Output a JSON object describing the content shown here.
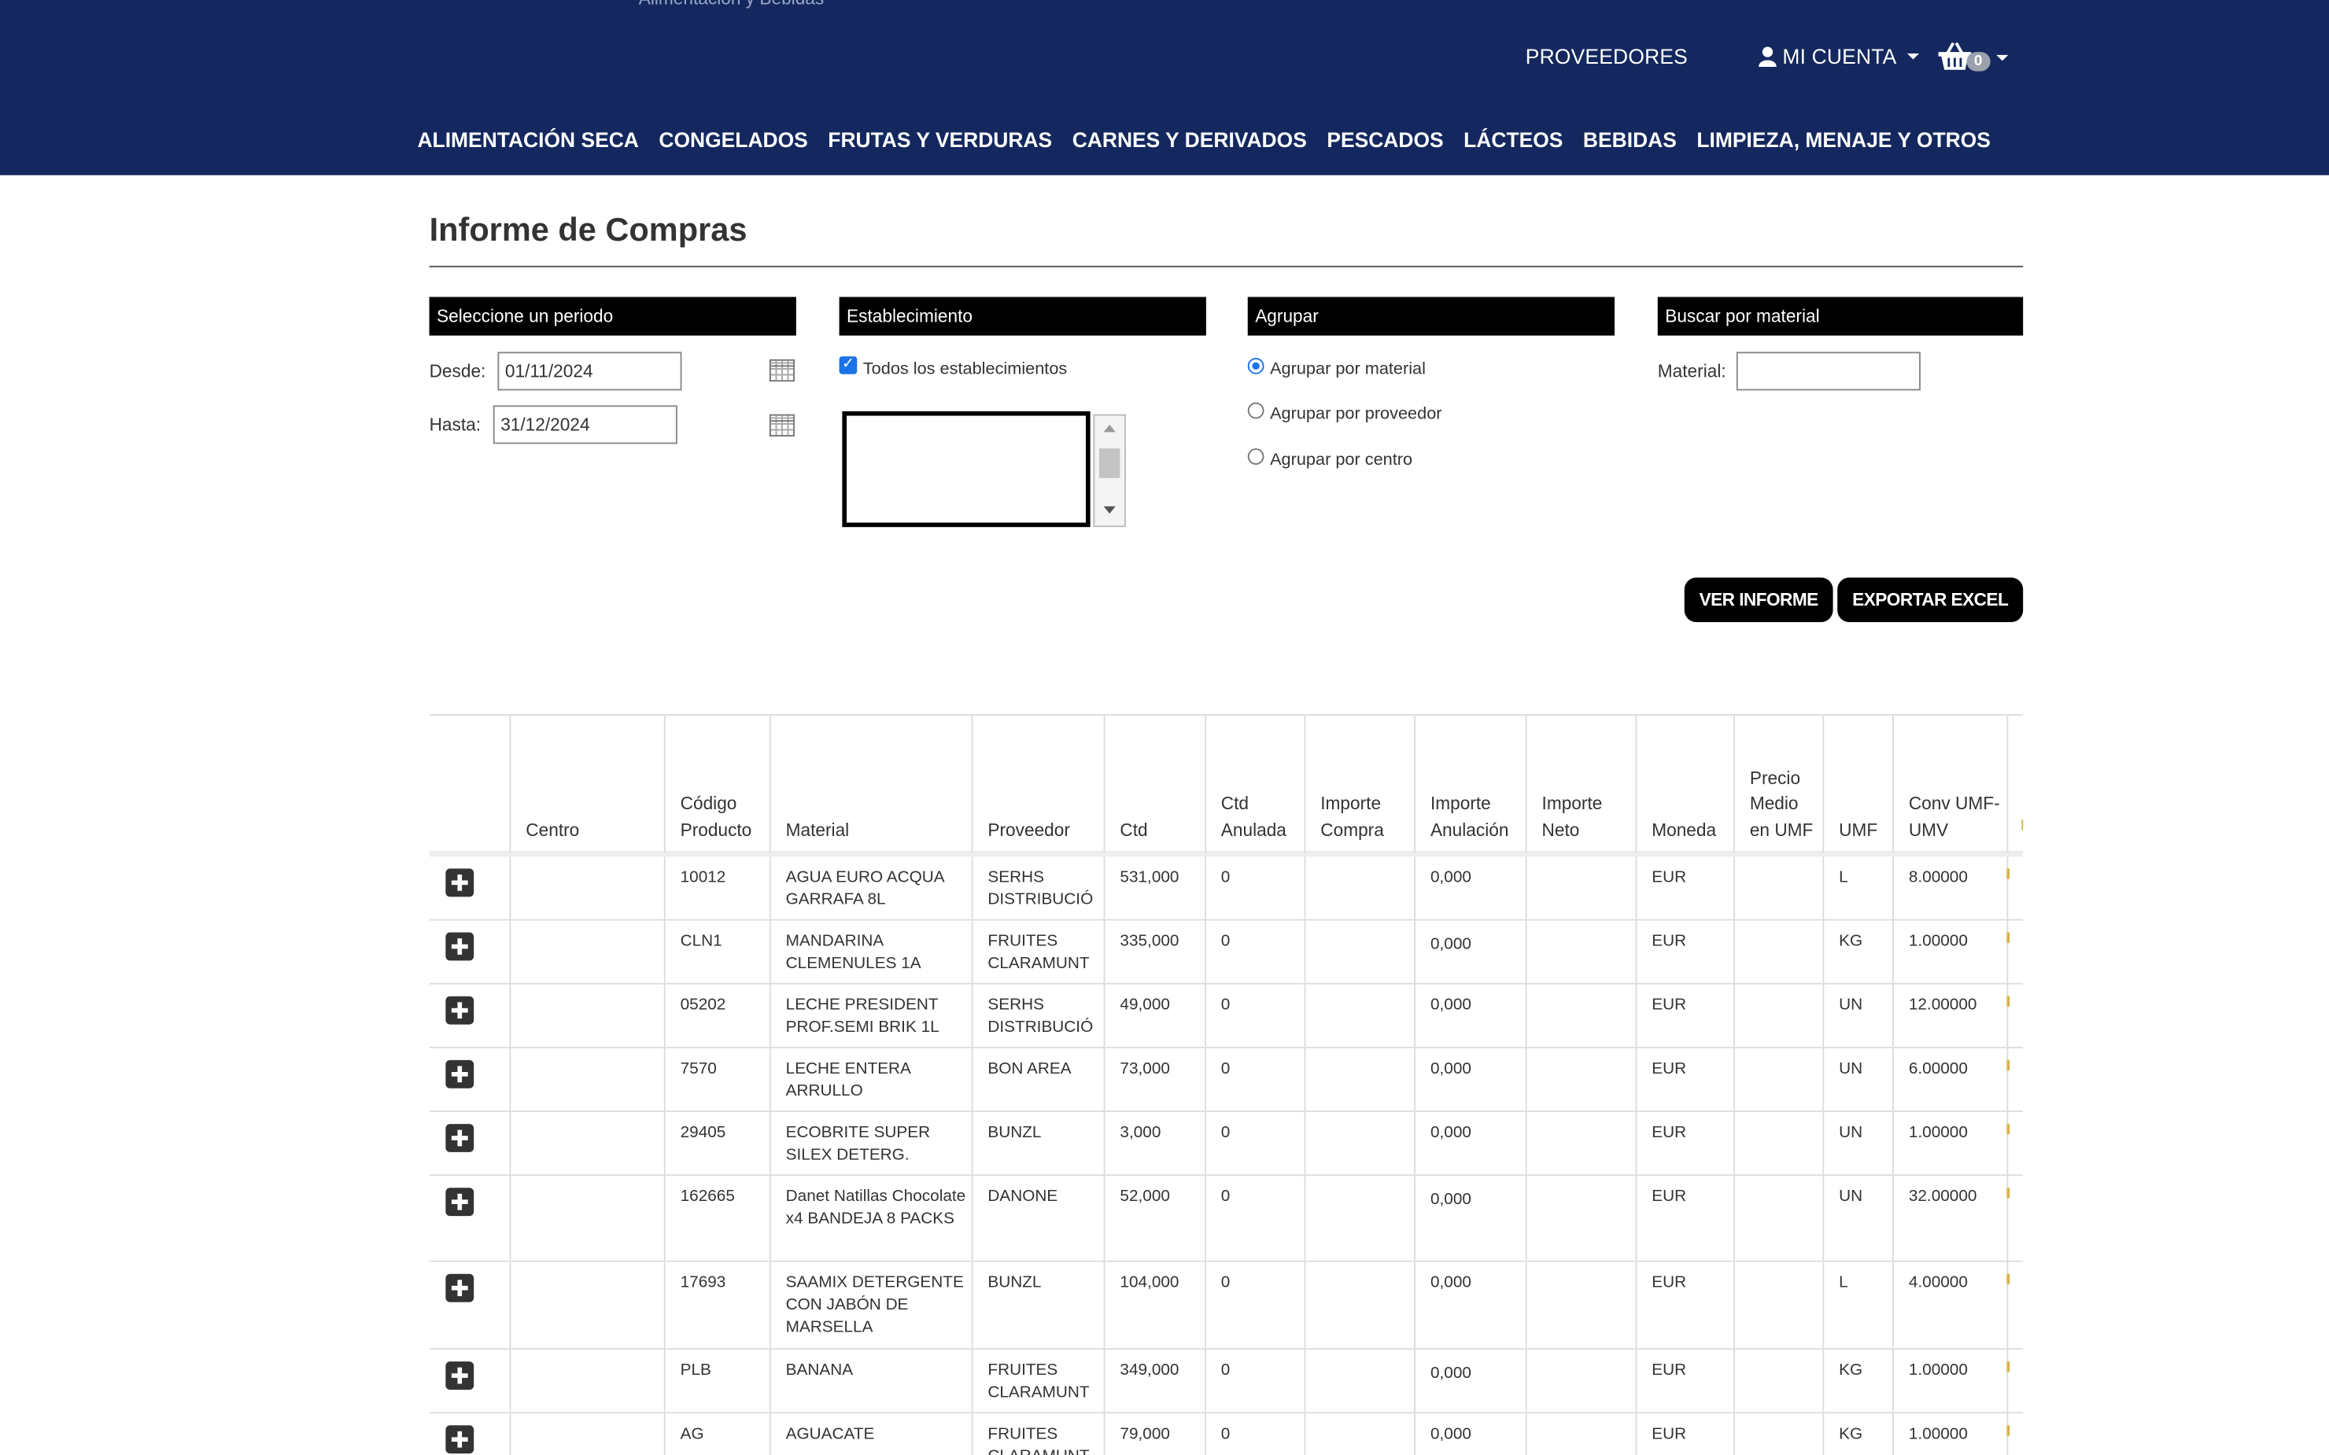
{
  "header": {
    "top_partial_text": "Alimentación y Bebidas",
    "nav_right": {
      "suppliers": "PROVEEDORES",
      "account": "MI CUENTA",
      "cart_count": "0"
    },
    "categories": [
      "ALIMENTACIÓN SECA",
      "CONGELADOS",
      "FRUTAS Y VERDURAS",
      "CARNES Y DERIVADOS",
      "PESCADOS",
      "LÁCTEOS",
      "BEBIDAS",
      "LIMPIEZA, MENAJE Y OTROS"
    ]
  },
  "page": {
    "title": "Informe de Compras"
  },
  "filters": {
    "period": {
      "heading": "Seleccione un periodo",
      "from_label": "Desde:",
      "from_value": "01/11/2024",
      "to_label": "Hasta:",
      "to_value": "31/12/2024"
    },
    "establishment": {
      "heading": "Establecimiento",
      "all_label": "Todos los establecimientos",
      "all_checked": true
    },
    "group": {
      "heading": "Agrupar",
      "options": [
        "Agrupar por material",
        "Agrupar por proveedor",
        "Agrupar por centro"
      ],
      "selected": "Agrupar por material"
    },
    "search": {
      "heading": "Buscar por material",
      "material_label": "Material:",
      "material_value": ""
    }
  },
  "actions": {
    "view_report": "VER INFORME",
    "export_excel": "EXPORTAR EXCEL"
  },
  "table": {
    "headers": [
      "Centro",
      "Código Producto",
      "Material",
      "Proveedor",
      "Ctd",
      "Ctd Anulada",
      "Importe Compra",
      "Importe Anulación",
      "Importe Neto",
      "Moneda",
      "Precio Medio en UMF",
      "UMF",
      "Conv UMF-UMV"
    ],
    "rows": [
      {
        "centro": "",
        "codigo": "10012",
        "material": "AGUA EURO ACQUA GARRAFA 8L",
        "proveedor": "SERHS DISTRIBUCIÓ",
        "ctd": "531,000",
        "anulada": "0",
        "compra": "",
        "anulacion": "0,000",
        "neto": "",
        "moneda": "EUR",
        "precio": "",
        "umf": "L",
        "conv": "8.00000"
      },
      {
        "centro": "",
        "codigo": "CLN1",
        "material": "MANDARINA CLEMENULES 1A",
        "proveedor": "FRUITES CLARAMUNT",
        "ctd": "335,000",
        "anulada": "0",
        "compra": "",
        "anulacion": "0,000",
        "neto": "",
        "moneda": "EUR",
        "precio": "",
        "umf": "KG",
        "conv": "1.00000"
      },
      {
        "centro": "",
        "codigo": "05202",
        "material": "LECHE PRESIDENT PROF.SEMI BRIK 1L",
        "proveedor": "SERHS DISTRIBUCIÓ",
        "ctd": "49,000",
        "anulada": "0",
        "compra": "",
        "anulacion": "0,000",
        "neto": "",
        "moneda": "EUR",
        "precio": "",
        "umf": "UN",
        "conv": "12.00000"
      },
      {
        "centro": "",
        "codigo": "7570",
        "material": "LECHE ENTERA ARRULLO",
        "proveedor": "BON AREA",
        "ctd": "73,000",
        "anulada": "0",
        "compra": "",
        "anulacion": "0,000",
        "neto": "",
        "moneda": "EUR",
        "precio": "",
        "umf": "UN",
        "conv": "6.00000"
      },
      {
        "centro": "",
        "codigo": "29405",
        "material": "ECOBRITE SUPER SILEX DETERG.",
        "proveedor": "BUNZL",
        "ctd": "3,000",
        "anulada": "0",
        "compra": "",
        "anulacion": "0,000",
        "neto": "",
        "moneda": "EUR",
        "precio": "",
        "umf": "UN",
        "conv": "1.00000"
      },
      {
        "centro": "",
        "codigo": "162665",
        "material": "Danet Natillas Chocolate x4 BANDEJA 8 PACKS",
        "proveedor": "DANONE",
        "ctd": "52,000",
        "anulada": "0",
        "compra": "",
        "anulacion": "0,000",
        "neto": "",
        "moneda": "EUR",
        "precio": "",
        "umf": "UN",
        "conv": "32.00000"
      },
      {
        "centro": "",
        "codigo": "17693",
        "material": "SAAMIX DETERGENTE CON JABÓN DE MARSELLA",
        "proveedor": "BUNZL",
        "ctd": "104,000",
        "anulada": "0",
        "compra": "",
        "anulacion": "0,000",
        "neto": "",
        "moneda": "EUR",
        "precio": "",
        "umf": "L",
        "conv": "4.00000"
      },
      {
        "centro": "",
        "codigo": "PLB",
        "material": "BANANA",
        "proveedor": "FRUITES CLARAMUNT",
        "ctd": "349,000",
        "anulada": "0",
        "compra": "",
        "anulacion": "0,000",
        "neto": "",
        "moneda": "EUR",
        "precio": "",
        "umf": "KG",
        "conv": "1.00000"
      },
      {
        "centro": "",
        "codigo": "AG",
        "material": "AGUACATE",
        "proveedor": "FRUITES CLARAMUNT",
        "ctd": "79,000",
        "anulada": "0",
        "compra": "",
        "anulacion": "0,000",
        "neto": "",
        "moneda": "EUR",
        "precio": "",
        "umf": "KG",
        "conv": "1.00000"
      }
    ]
  }
}
